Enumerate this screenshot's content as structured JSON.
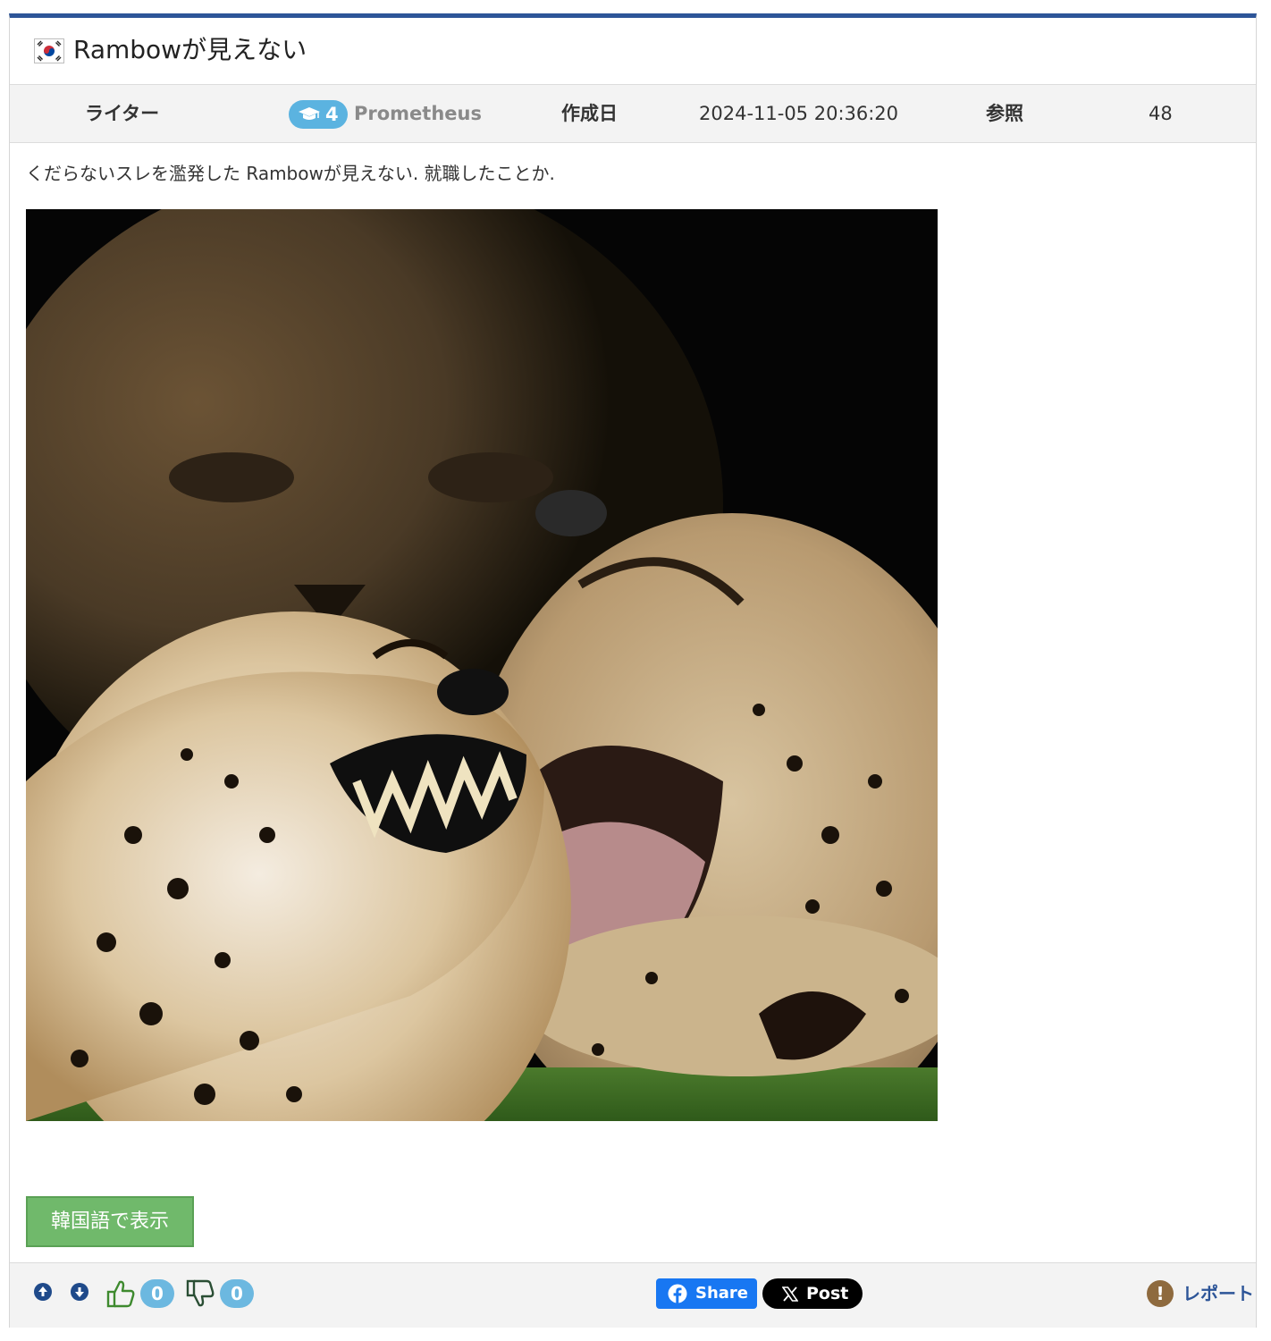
{
  "post": {
    "title": "Rambowが見えない",
    "flag_icon": "south-korea-flag-icon",
    "body": "くだらないスレを濫発した Rambowが見えない. 就職したことか."
  },
  "meta": {
    "writer_label": "ライター",
    "writer_level": "4",
    "writer_name": "Prometheus",
    "date_label": "作成日",
    "date_value": "2024-11-05 20:36:20",
    "views_label": "参照",
    "views_value": "48"
  },
  "image": {
    "icon": "cheetahs-laughing-photo"
  },
  "translate_button": "韓国語で表示",
  "footer": {
    "likes": "0",
    "dislikes": "0",
    "share_label": "Share",
    "post_label": "Post",
    "report_label": "レポート",
    "report_icon_glyph": "!"
  },
  "colors": {
    "accent": "#2d5598",
    "translate_button": "#70b96b",
    "badge": "#6cb8e0",
    "facebook": "#1877f2"
  }
}
